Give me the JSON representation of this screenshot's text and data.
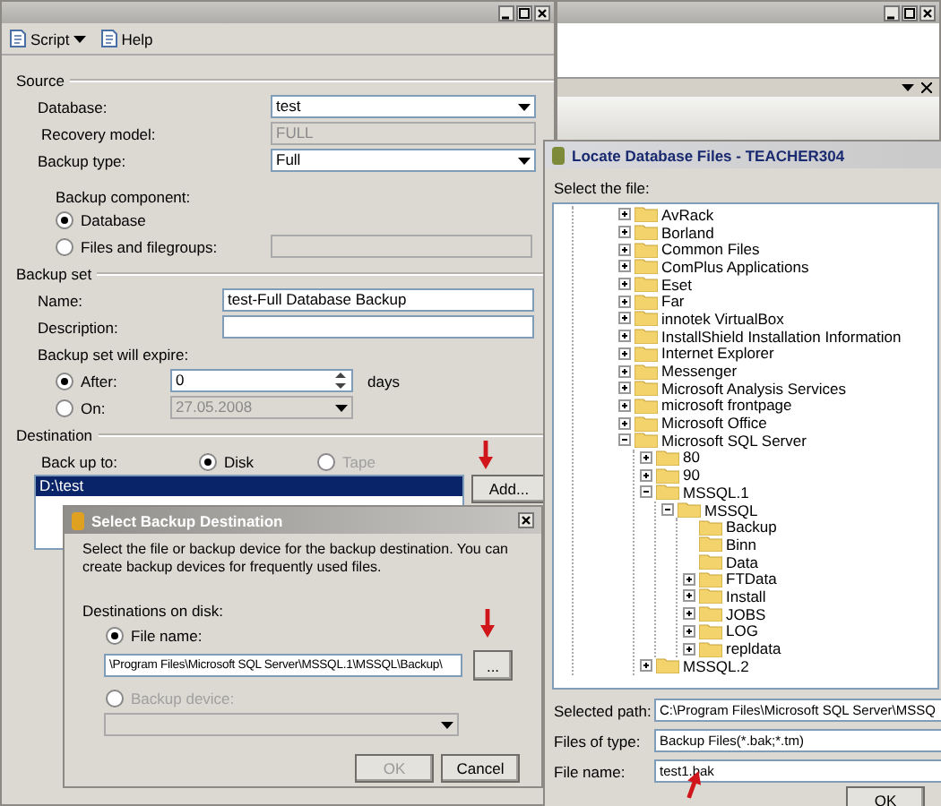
{
  "main_window": {
    "toolbar": [
      {
        "label": "Script",
        "kind": "dropdown"
      },
      {
        "label": "Help",
        "kind": "plain"
      }
    ],
    "source": {
      "title": "Source",
      "database": {
        "label": "Database:",
        "value": "test"
      },
      "recovery_model": {
        "label": "Recovery model:",
        "value": "FULL"
      },
      "backup_type": {
        "label": "Backup type:",
        "value": "Full"
      },
      "component_label": "Backup component:",
      "components": [
        {
          "label": "Database",
          "selected": true
        },
        {
          "label": "Files and filegroups:",
          "selected": false
        }
      ]
    },
    "backup_set": {
      "title": "Backup set",
      "name": {
        "label": "Name:",
        "value": "test-Full Database Backup"
      },
      "description": {
        "label": "Description:"
      },
      "expire_label": "Backup set will expire:",
      "after": {
        "label": "After:",
        "selected": true,
        "value": "0",
        "unit": "days"
      },
      "on": {
        "label": "On:",
        "selected": false,
        "value": "27.05.2008"
      }
    },
    "destination": {
      "title": "Destination",
      "back_up_to": "Back up to:",
      "media": [
        {
          "label": "Disk",
          "selected": true,
          "disabled": false
        },
        {
          "label": "Tape",
          "selected": false,
          "disabled": true
        }
      ],
      "paths": [
        {
          "label": "D:\\test",
          "selected": true
        }
      ],
      "add_button": "Add..."
    }
  },
  "locate_dialog": {
    "title": "Locate Database Files - TEACHER304",
    "prompt": "Select the file:",
    "tree": [
      {
        "label": "AvRack",
        "expanded": false
      },
      {
        "label": "Borland",
        "expanded": false
      },
      {
        "label": "Common Files",
        "expanded": false
      },
      {
        "label": "ComPlus Applications",
        "expanded": false
      },
      {
        "label": "Eset",
        "expanded": false
      },
      {
        "label": "Far",
        "expanded": false
      },
      {
        "label": "innotek VirtualBox",
        "expanded": false
      },
      {
        "label": "InstallShield Installation Information",
        "expanded": false
      },
      {
        "label": "Internet Explorer",
        "expanded": false
      },
      {
        "label": "Messenger",
        "expanded": false
      },
      {
        "label": "Microsoft Analysis Services",
        "expanded": false
      },
      {
        "label": "microsoft frontpage",
        "expanded": false
      },
      {
        "label": "Microsoft Office",
        "expanded": false
      },
      {
        "label": "Microsoft SQL Server",
        "expanded": true,
        "children": [
          {
            "label": "80",
            "expanded": false
          },
          {
            "label": "90",
            "expanded": false
          },
          {
            "label": "MSSQL.1",
            "expanded": true,
            "children": [
              {
                "label": "MSSQL",
                "expanded": true,
                "children": [
                  {
                    "label": "Backup"
                  },
                  {
                    "label": "Binn"
                  },
                  {
                    "label": "Data"
                  },
                  {
                    "label": "FTData",
                    "expanded": false
                  },
                  {
                    "label": "Install",
                    "expanded": false
                  },
                  {
                    "label": "JOBS",
                    "expanded": false
                  },
                  {
                    "label": "LOG",
                    "expanded": false
                  },
                  {
                    "label": "repldata",
                    "expanded": false
                  }
                ]
              }
            ]
          },
          {
            "label": "MSSQL.2",
            "expanded": false
          }
        ]
      }
    ],
    "selected_path": {
      "label": "Selected path:",
      "value": "C:\\Program Files\\Microsoft SQL Server\\MSSQ"
    },
    "files_of_type": {
      "label": "Files of type:",
      "value": "Backup Files(*.bak;*.tm)"
    },
    "file_name": {
      "label": "File name:",
      "value": "test1.bak"
    },
    "ok_button": "OK"
  },
  "backup_destination_dialog": {
    "title": "Select Backup Destination",
    "description": "Select the file or backup device for the backup destination. You can create backup devices for frequently used files.",
    "destinations_label": "Destinations on disk:",
    "file_name": {
      "label": "File name:",
      "selected": true,
      "value": "\\Program Files\\Microsoft SQL Server\\MSSQL.1\\MSSQL\\Backup\\"
    },
    "browse_button": "...",
    "backup_device": {
      "label": "Backup device:",
      "selected": false,
      "disabled": true
    },
    "buttons": [
      {
        "label": "OK",
        "disabled": true
      },
      {
        "label": "Cancel",
        "disabled": false
      }
    ]
  }
}
